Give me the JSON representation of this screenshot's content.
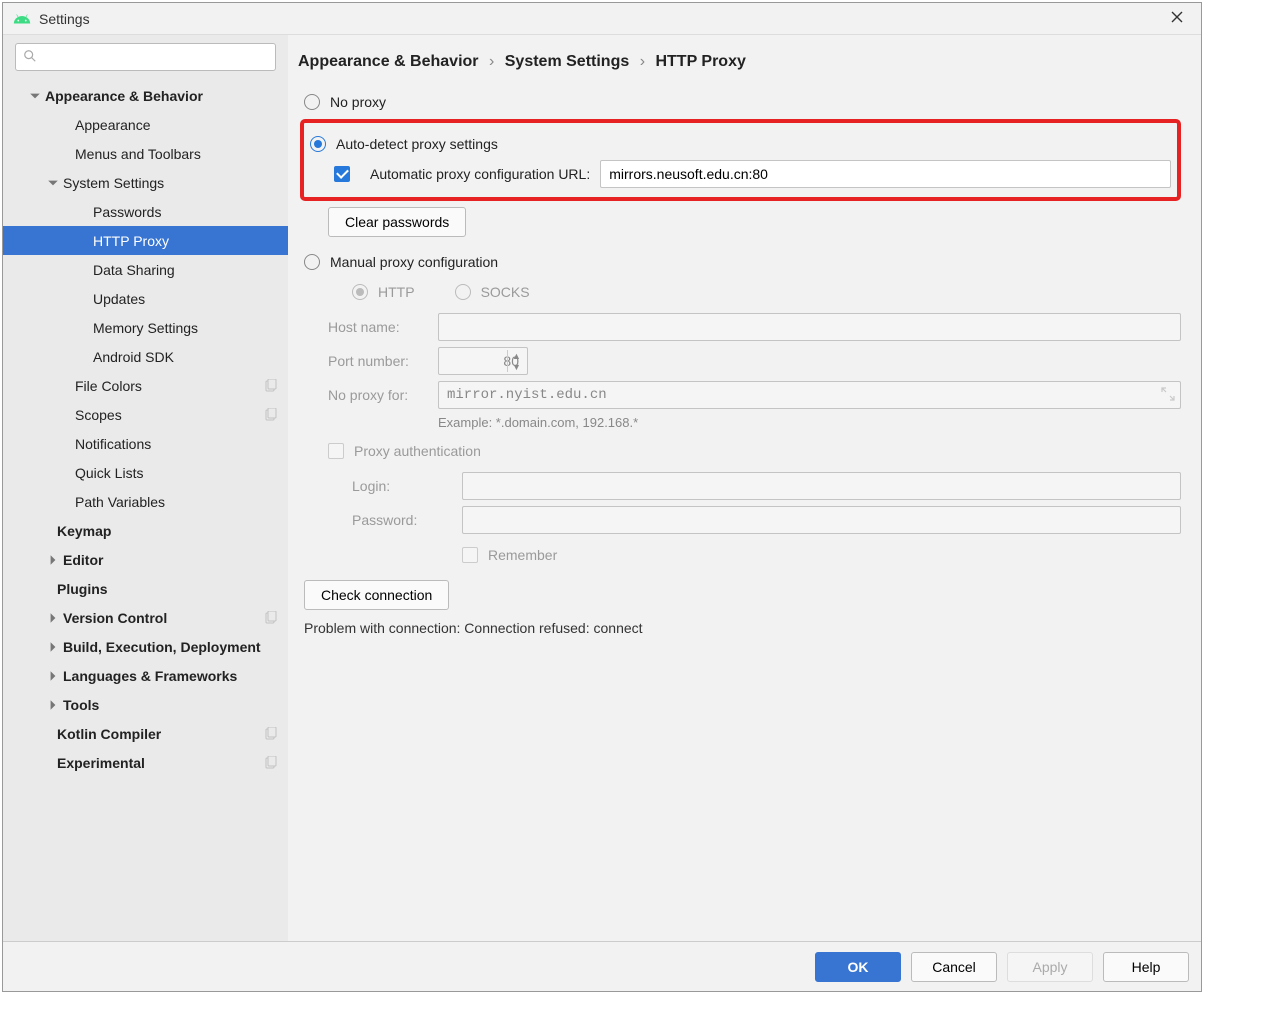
{
  "window": {
    "title": "Settings"
  },
  "search": {
    "placeholder": ""
  },
  "tree": [
    {
      "label": "Appearance & Behavior",
      "bold": true,
      "expanded": true,
      "pad": 1,
      "arrow": "down"
    },
    {
      "label": "Appearance",
      "pad": 3
    },
    {
      "label": "Menus and Toolbars",
      "pad": 3
    },
    {
      "label": "System Settings",
      "bold": false,
      "expanded": true,
      "pad": 2,
      "arrow": "down"
    },
    {
      "label": "Passwords",
      "pad": 4
    },
    {
      "label": "HTTP Proxy",
      "pad": 4,
      "selected": true
    },
    {
      "label": "Data Sharing",
      "pad": 4
    },
    {
      "label": "Updates",
      "pad": 4
    },
    {
      "label": "Memory Settings",
      "pad": 4
    },
    {
      "label": "Android SDK",
      "pad": 4
    },
    {
      "label": "File Colors",
      "pad": 3,
      "badge": true
    },
    {
      "label": "Scopes",
      "pad": 3,
      "badge": true
    },
    {
      "label": "Notifications",
      "pad": 3
    },
    {
      "label": "Quick Lists",
      "pad": 3
    },
    {
      "label": "Path Variables",
      "pad": 3
    },
    {
      "label": "Keymap",
      "bold": true,
      "pad": 2
    },
    {
      "label": "Editor",
      "bold": true,
      "pad": 2,
      "arrow": "right"
    },
    {
      "label": "Plugins",
      "bold": true,
      "pad": 2
    },
    {
      "label": "Version Control",
      "bold": true,
      "pad": 2,
      "arrow": "right",
      "badge": true
    },
    {
      "label": "Build, Execution, Deployment",
      "bold": true,
      "pad": 2,
      "arrow": "right"
    },
    {
      "label": "Languages & Frameworks",
      "bold": true,
      "pad": 2,
      "arrow": "right"
    },
    {
      "label": "Tools",
      "bold": true,
      "pad": 2,
      "arrow": "right"
    },
    {
      "label": "Kotlin Compiler",
      "bold": true,
      "pad": 2,
      "badge": true
    },
    {
      "label": "Experimental",
      "bold": true,
      "pad": 2,
      "badge": true
    }
  ],
  "breadcrumb": {
    "a": "Appearance & Behavior",
    "b": "System Settings",
    "c": "HTTP Proxy"
  },
  "proxy": {
    "no_proxy_label": "No proxy",
    "auto_label": "Auto-detect proxy settings",
    "auto_url_label": "Automatic proxy configuration URL:",
    "auto_url_value": "mirrors.neusoft.edu.cn:80",
    "clear_pw_btn": "Clear passwords",
    "manual_label": "Manual proxy configuration",
    "http_label": "HTTP",
    "socks_label": "SOCKS",
    "host_label": "Host name:",
    "host_value": "",
    "port_label": "Port number:",
    "port_value": "80",
    "noproxyfor_label": "No proxy for:",
    "noproxyfor_value": "mirror.nyist.edu.cn",
    "noproxyfor_hint": "Example: *.domain.com, 192.168.*",
    "auth_label": "Proxy authentication",
    "login_label": "Login:",
    "login_value": "",
    "pw_label": "Password:",
    "pw_value": "",
    "remember_label": "Remember",
    "check_btn": "Check connection",
    "status": "Problem with connection: Connection refused: connect"
  },
  "footer": {
    "ok": "OK",
    "cancel": "Cancel",
    "apply": "Apply",
    "help": "Help"
  }
}
